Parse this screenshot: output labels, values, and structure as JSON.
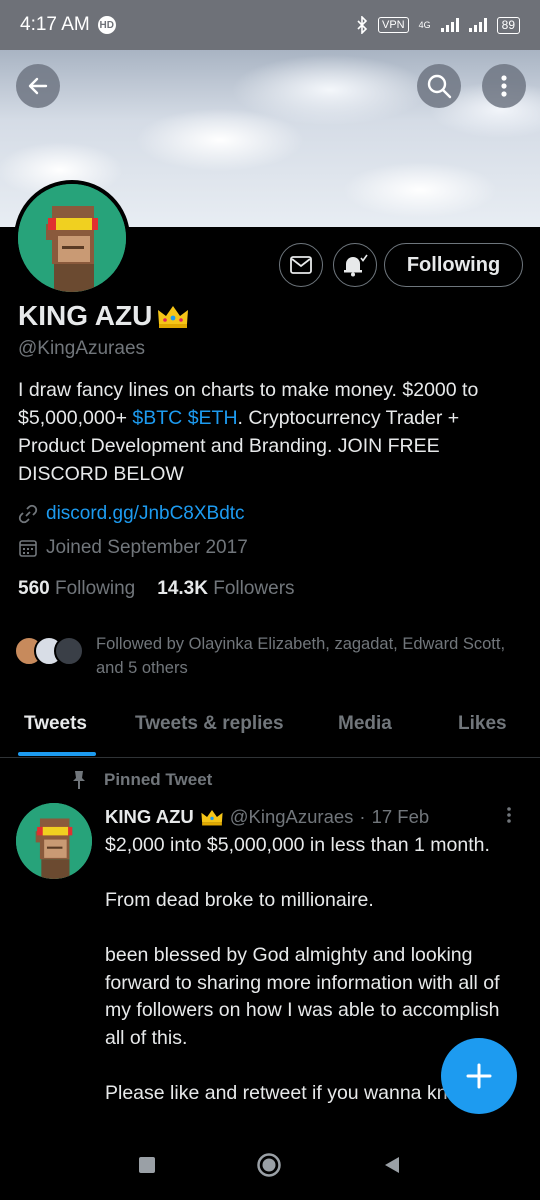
{
  "status_bar": {
    "time": "4:17 AM",
    "hd_label": "HD",
    "vpn_label": "VPN",
    "network_label": "4G",
    "battery": "89"
  },
  "profile": {
    "name": "KING AZU",
    "handle": "@KingAzuraes",
    "bio_lines": {
      "part1": "I draw fancy lines on charts to make money. $2000 to $5,000,000+ ",
      "tag1": "$BTC",
      "tag2": "$ETH",
      "part2": ". Cryptocurrency Trader + Product Development and Branding. JOIN FREE DISCORD BELOW"
    },
    "link": "discord.gg/JnbC8XBdtc",
    "joined": "Joined September 2017",
    "following_count": "560",
    "following_label": "Following",
    "followers_count": "14.3K",
    "followers_label": "Followers",
    "followed_by": "Followed by Olayinka Elizabeth, zagadat, Edward Scott, and 5 others",
    "follow_button": "Following"
  },
  "tabs": [
    "Tweets",
    "Tweets & replies",
    "Media",
    "Likes"
  ],
  "pinned_tweet": {
    "pinned_label": "Pinned Tweet",
    "author_name": "KING AZU",
    "author_handle": "@KingAzuraes",
    "separator": "·",
    "date": "17 Feb",
    "text": "$2,000 into $5,000,000 in less than 1 month.\n\nFrom dead broke to millionaire.\n\nbeen blessed by God almighty and looking forward to sharing more information with all of my followers on how I was able to accomplish all of this.\n\nPlease like and retweet if you wanna know"
  },
  "colors": {
    "accent": "#1d9bf0",
    "background": "#000000",
    "secondary_text": "#71767b",
    "primary_text": "#e7e9ea",
    "avatar_bg": "#27a37a"
  },
  "icons": {
    "back": "arrow-left-icon",
    "search": "search-icon",
    "more": "more-vertical-icon",
    "message": "envelope-icon",
    "notifications": "bell-check-icon",
    "link": "link-icon",
    "calendar": "calendar-icon",
    "pin": "pin-icon",
    "compose": "plus-icon"
  }
}
